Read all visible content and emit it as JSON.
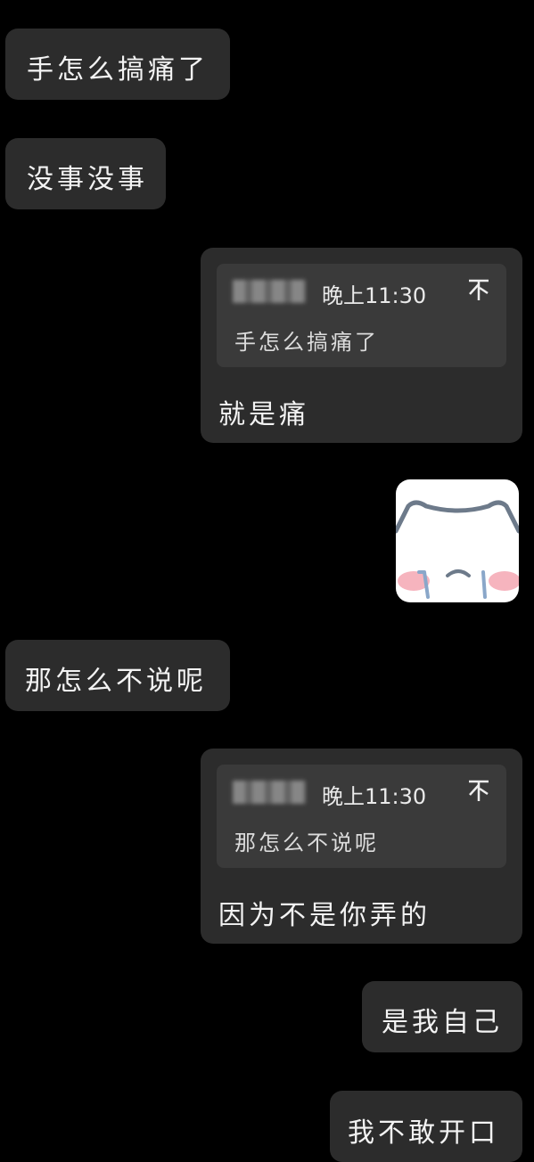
{
  "messages": [
    {
      "side": "left",
      "text": "手怎么搞痛了"
    },
    {
      "side": "left",
      "text": "没事没事"
    },
    {
      "side": "right",
      "quote": {
        "time": "晚上11:30",
        "text": "手怎么搞痛了"
      },
      "text": "就是痛"
    },
    {
      "side": "right",
      "type": "sticker",
      "sticker": "crying-cat-sticker"
    },
    {
      "side": "left",
      "text": "那怎么不说呢"
    },
    {
      "side": "right",
      "quote": {
        "time": "晚上11:30",
        "text": "那怎么不说呢"
      },
      "text": "因为不是你弄的"
    },
    {
      "side": "right",
      "text": "是我自己"
    },
    {
      "side": "right",
      "text": "我不敢开口"
    }
  ],
  "icons": {
    "quote_action": "pin-top-icon"
  },
  "colors": {
    "background": "#000000",
    "bubble": "#2c2c2c",
    "quote_box": "#3a3a3a",
    "text": "#f3f3f3"
  }
}
